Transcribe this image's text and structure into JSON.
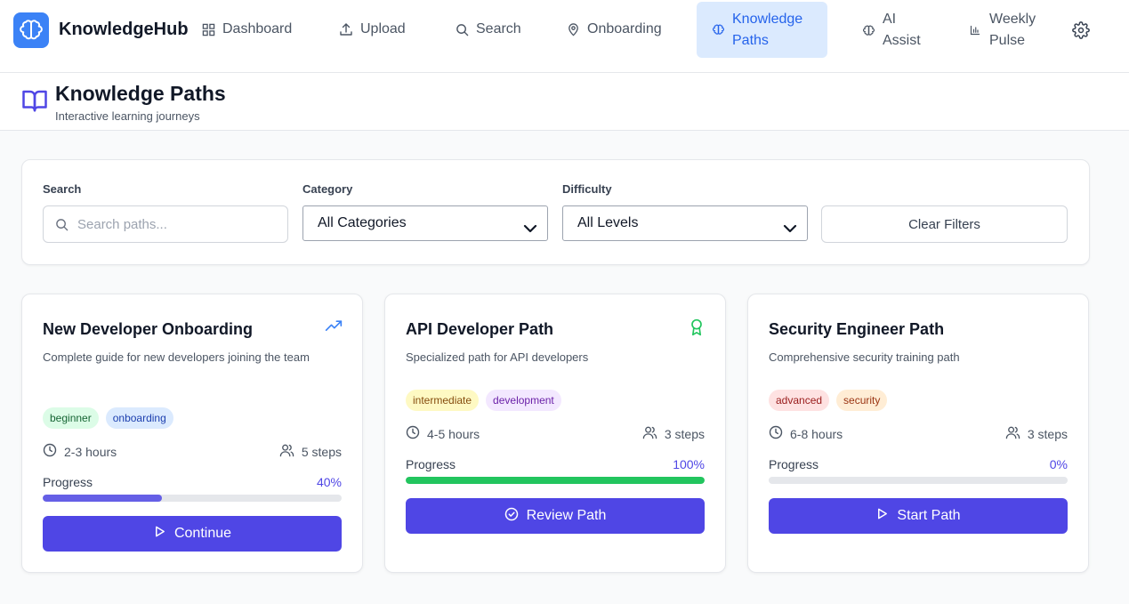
{
  "app": {
    "brand": "KnowledgeHub",
    "logo_icon": "brain-icon"
  },
  "nav": [
    {
      "label": "Dashboard",
      "icon": "grid-icon"
    },
    {
      "label": "Upload",
      "icon": "upload-icon"
    },
    {
      "label": "Search",
      "icon": "search-icon"
    },
    {
      "label": "Onboarding",
      "icon": "map-pin-icon"
    },
    {
      "label_line1": "Knowledge",
      "label_line2": "Paths",
      "icon": "brain-icon",
      "active": true
    },
    {
      "label_line1": "AI",
      "label_line2": "Assist",
      "icon": "brain-icon"
    },
    {
      "label_line1": "Weekly",
      "label_line2": "Pulse",
      "icon": "bar-chart-icon"
    }
  ],
  "page": {
    "title": "Knowledge Paths",
    "subtitle": "Interactive learning journeys",
    "icon": "book-open-icon"
  },
  "filters": {
    "search_label": "Search",
    "search_placeholder": "Search paths...",
    "search_value": "",
    "category_label": "Category",
    "category_value": "All Categories",
    "difficulty_label": "Difficulty",
    "difficulty_value": "All Levels",
    "clear_label": "Clear Filters"
  },
  "progress_label": "Progress",
  "paths": [
    {
      "title": "New Developer Onboarding",
      "description": "Complete guide for new developers joining the team",
      "status_icon": "trending-up-icon",
      "tags": [
        "beginner",
        "onboarding"
      ],
      "duration": "2-3 hours",
      "steps": "5 steps",
      "progress": 40,
      "progress_text": "40%",
      "action": "Continue",
      "action_icon": "play-icon"
    },
    {
      "title": "API Developer Path",
      "description": "Specialized path for API developers",
      "status_icon": "award-icon",
      "tags": [
        "intermediate",
        "development"
      ],
      "duration": "4-5 hours",
      "steps": "3 steps",
      "progress": 100,
      "progress_text": "100%",
      "action": "Review Path",
      "action_icon": "check-circle-icon"
    },
    {
      "title": "Security Engineer Path",
      "description": "Comprehensive security training path",
      "status_icon": "",
      "tags": [
        "advanced",
        "security"
      ],
      "duration": "6-8 hours",
      "steps": "3 steps",
      "progress": 0,
      "progress_text": "0%",
      "action": "Start Path",
      "action_icon": "play-icon"
    }
  ],
  "colors": {
    "primary": "#4f46e5",
    "complete": "#22c55e",
    "nav_active_bg": "#dbeafe",
    "nav_active_text": "#2563eb",
    "tag_beginner": "#dcfce7",
    "tag_onboarding": "#dbeafe",
    "tag_intermediate": "#fef9c3",
    "tag_development": "#f3e8ff",
    "tag_advanced": "#fee2e2",
    "tag_security": "#ffedd5"
  }
}
